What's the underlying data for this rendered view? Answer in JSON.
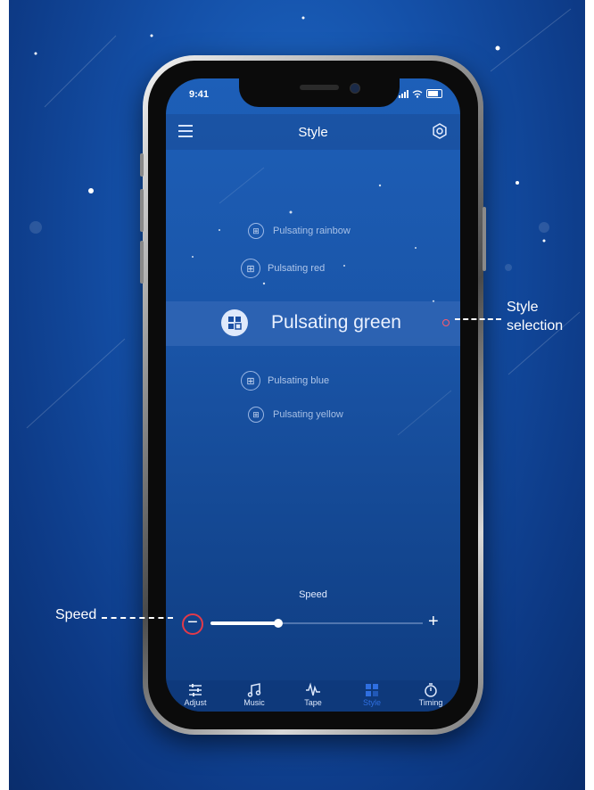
{
  "status_bar": {
    "time": "9:41"
  },
  "header": {
    "title": "Style"
  },
  "styles": [
    {
      "label": "Pulsating rainbow"
    },
    {
      "label": "Pulsating red"
    },
    {
      "label": "Pulsating green"
    },
    {
      "label": "Pulsating blue"
    },
    {
      "label": "Pulsating yellow"
    }
  ],
  "selected_style": "Pulsating green",
  "speed": {
    "label": "Speed",
    "minus": "−",
    "plus": "+",
    "level": 0.32
  },
  "tabs": [
    {
      "label": "Adjust",
      "icon": "sliders-icon"
    },
    {
      "label": "Music",
      "icon": "music-note-icon"
    },
    {
      "label": "Tape",
      "icon": "waveform-icon"
    },
    {
      "label": "Style",
      "icon": "grid-icon",
      "active": true
    },
    {
      "label": "Timing",
      "icon": "timer-icon"
    }
  ],
  "annotations": {
    "speed": "Speed",
    "style_selection_line1": "Style",
    "style_selection_line2": "selection"
  },
  "colors": {
    "accent": "#2f6fe0",
    "marker": "#e23a4a",
    "background": "#1450a8"
  }
}
